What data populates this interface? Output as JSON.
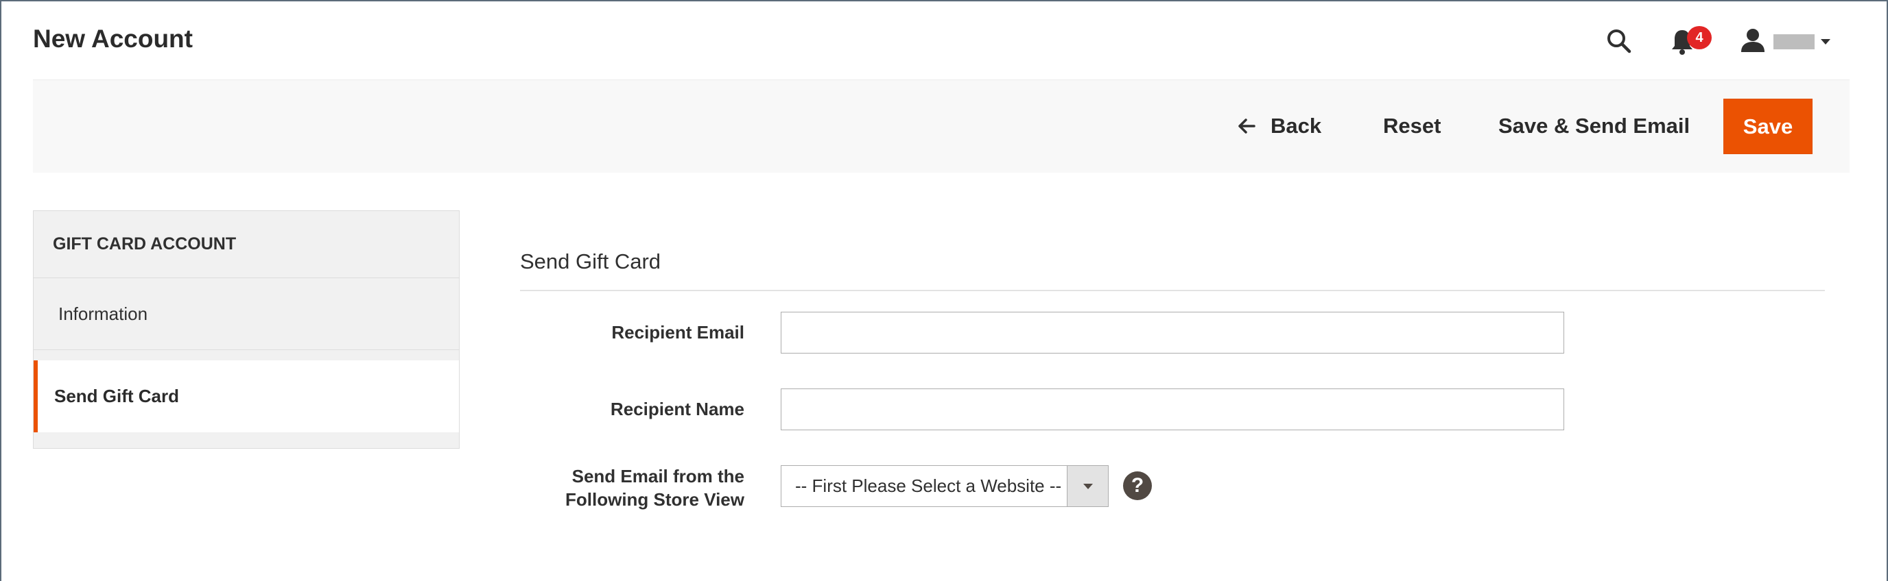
{
  "header": {
    "page_title": "New Account",
    "notification_count": "4",
    "icons": [
      "search-icon",
      "bell-icon",
      "user-icon",
      "chevron-down-icon"
    ]
  },
  "toolbar": {
    "back_label": "Back",
    "reset_label": "Reset",
    "save_send_label": "Save & Send Email",
    "save_label": "Save",
    "accent_color": "#eb5202"
  },
  "sidebar": {
    "heading": "GIFT CARD ACCOUNT",
    "items": [
      {
        "label": "Information",
        "active": false
      },
      {
        "label": "Send Gift Card",
        "active": true
      }
    ]
  },
  "form": {
    "section_title": "Send Gift Card",
    "recipient_email": {
      "label": "Recipient Email",
      "value": ""
    },
    "recipient_name": {
      "label": "Recipient Name",
      "value": ""
    },
    "store_view": {
      "label_line1": "Send Email from the",
      "label_line2": "Following Store View",
      "selected": "-- First Please Select a Website --"
    },
    "help_glyph": "?"
  }
}
